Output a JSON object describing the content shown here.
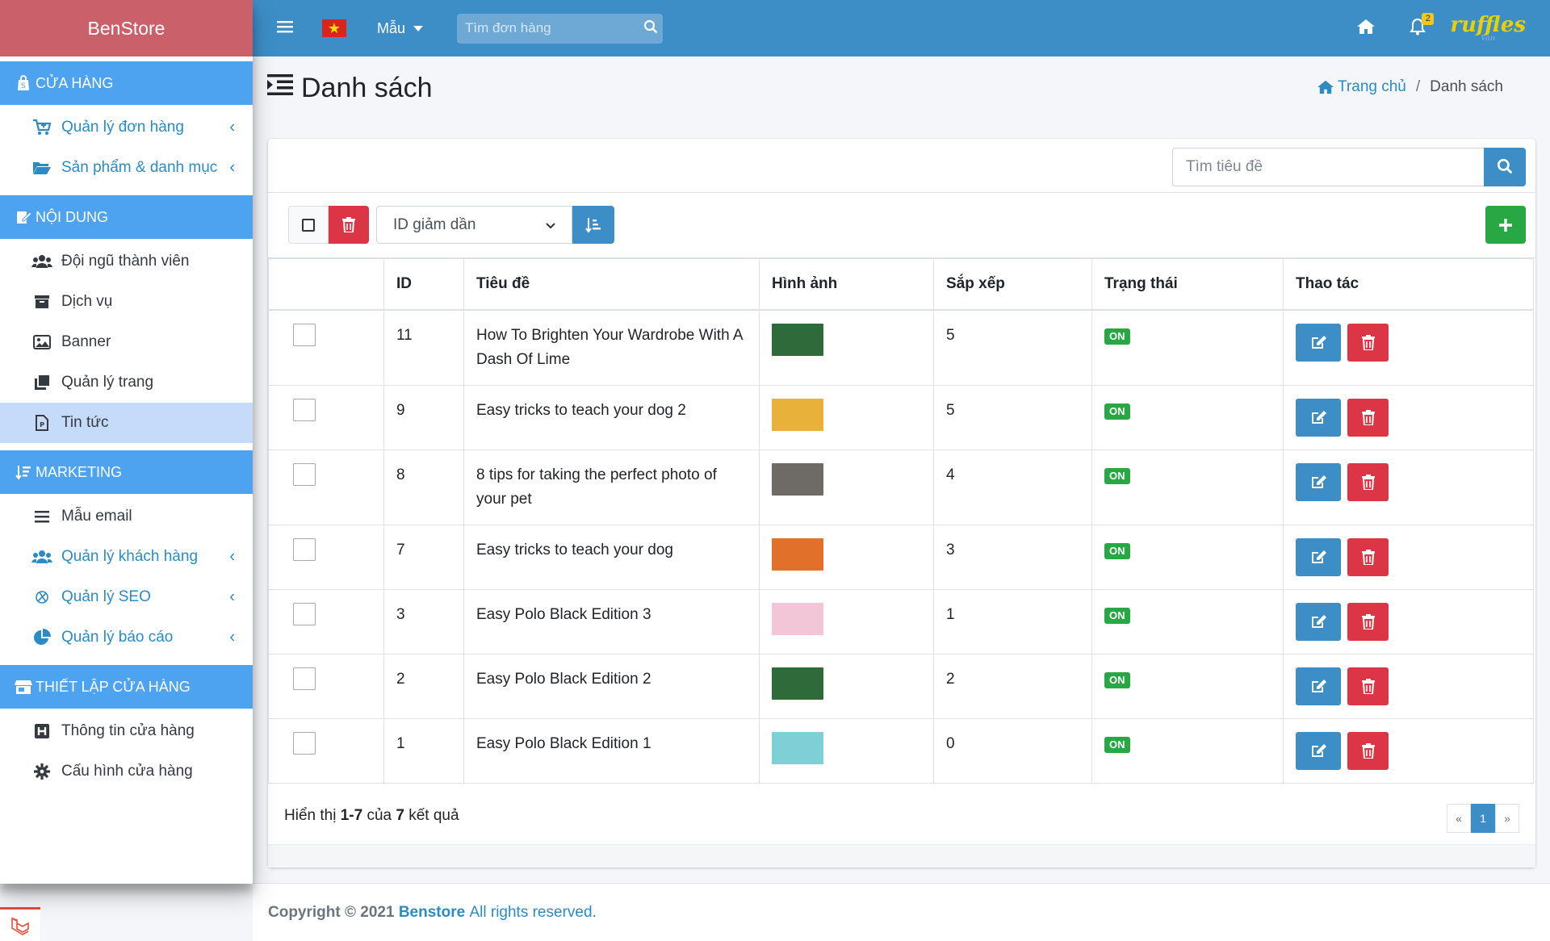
{
  "sidebar": {
    "brand": "BenStore",
    "sections": [
      {
        "title": "CỬA HÀNG",
        "icon": "shopify-bag-icon"
      },
      {
        "title": "NỘI DUNG",
        "icon": "edit-document-icon"
      },
      {
        "title": "MARKETING",
        "icon": "sort-amount-icon"
      },
      {
        "title": "THIẾT LẬP CỬA HÀNG",
        "icon": "store-icon"
      }
    ],
    "items": [
      {
        "label": "Quản lý đơn hàng",
        "icon": "cart-plus-icon"
      },
      {
        "label": "Sản phẩm & danh mục",
        "icon": "folder-open-icon"
      },
      {
        "label": "Đội ngũ thành viên",
        "icon": "users-icon"
      },
      {
        "label": "Dịch vụ",
        "icon": "archive-box-icon"
      },
      {
        "label": "Banner",
        "icon": "image-icon"
      },
      {
        "label": "Quản lý trang",
        "icon": "clone-pages-icon"
      },
      {
        "label": "Tin tức",
        "icon": "file-news-icon"
      },
      {
        "label": "Mẫu email",
        "icon": "bars-icon"
      },
      {
        "label": "Quản lý khách hàng",
        "icon": "users-icon"
      },
      {
        "label": "Quản lý SEO",
        "icon": "seo-icon"
      },
      {
        "label": "Quản lý báo cáo",
        "icon": "pie-chart-icon"
      },
      {
        "label": "Thông tin cửa hàng",
        "icon": "h-square-icon"
      },
      {
        "label": "Cấu hình cửa hàng",
        "icon": "gear-icon"
      }
    ]
  },
  "header": {
    "language": "Mẫu",
    "search_placeholder": "Tìm đơn hàng",
    "notification_count": "2",
    "logo_text": "ruffles",
    "logo_sub": "Vân"
  },
  "page": {
    "title": "Danh sách",
    "breadcrumb_home": "Trang chủ",
    "breadcrumb_current": "Danh sách"
  },
  "toolbar": {
    "title_search_placeholder": "Tìm tiêu đề",
    "sort_value": "ID giảm dần"
  },
  "table": {
    "headers": [
      "",
      "ID",
      "Tiêu đề",
      "Hình ảnh",
      "Sắp xếp",
      "Trạng thái",
      "Thao tác"
    ],
    "rows": [
      {
        "id": "11",
        "title": "How To Brighten Your Wardrobe With A Dash Of Lime",
        "order": "5",
        "status": "ON",
        "thumb_color": "#2f6b3a"
      },
      {
        "id": "9",
        "title": "Easy tricks to teach your dog 2",
        "order": "5",
        "status": "ON",
        "thumb_color": "#e8b23a"
      },
      {
        "id": "8",
        "title": "8 tips for taking the perfect photo of your pet",
        "order": "4",
        "status": "ON",
        "thumb_color": "#6e6a66"
      },
      {
        "id": "7",
        "title": "Easy tricks to teach your dog",
        "order": "3",
        "status": "ON",
        "thumb_color": "#e0702a"
      },
      {
        "id": "3",
        "title": "Easy Polo Black Edition 3",
        "order": "1",
        "status": "ON",
        "thumb_color": "#f2c6d6"
      },
      {
        "id": "2",
        "title": "Easy Polo Black Edition 2",
        "order": "2",
        "status": "ON",
        "thumb_color": "#2f6b3a"
      },
      {
        "id": "1",
        "title": "Easy Polo Black Edition 1",
        "order": "0",
        "status": "ON",
        "thumb_color": "#7fcfd6"
      }
    ]
  },
  "footer_summary": {
    "prefix": "Hiển thị",
    "range": "1-7",
    "of": "của",
    "total": "7",
    "suffix": "kết quả"
  },
  "pagination": {
    "prev": "«",
    "current": "1",
    "next": "»"
  },
  "footer": {
    "copyright": "Copyright © 2021",
    "brand": "Benstore",
    "rights": "All rights reserved."
  },
  "colors": {
    "brand_bg": "#c9606a",
    "section_bg": "#4da3ef",
    "header_bg": "#3d8ec7",
    "primary": "#3d8ec7",
    "danger": "#dc3545",
    "success": "#28a745"
  }
}
